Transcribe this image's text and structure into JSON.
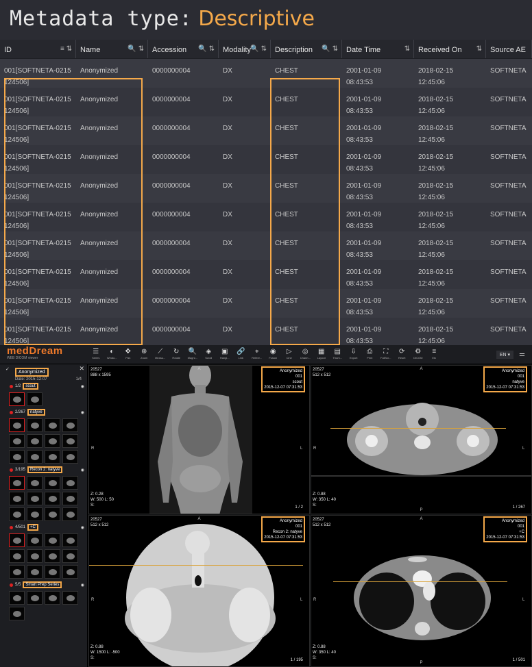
{
  "title": {
    "prefix": "Metadata type:",
    "accent": "Descriptive"
  },
  "table": {
    "columns": [
      "ID",
      "Name",
      "Accession",
      "Modality",
      "Description",
      "Date Time",
      "Received On",
      "Source AE"
    ],
    "column_icons": [
      "≡ ⇅",
      "🔍 ⇅",
      "🔍 ⇅",
      "🔍 ⇅",
      "🔍 ⇅",
      "⇅",
      "⇅",
      ""
    ],
    "rows": [
      [
        "001[SOFTNETA-0215124506]",
        "Anonymized",
        "0000000004",
        "DX",
        "CHEST",
        "2001-01-09 08:43:53",
        "2018-02-15 12:45:06",
        "SOFTNETA"
      ],
      [
        "001[SOFTNETA-0215124506]",
        "Anonymized",
        "0000000004",
        "DX",
        "CHEST",
        "2001-01-09 08:43:53",
        "2018-02-15 12:45:06",
        "SOFTNETA"
      ],
      [
        "001[SOFTNETA-0215124506]",
        "Anonymized",
        "0000000004",
        "DX",
        "CHEST",
        "2001-01-09 08:43:53",
        "2018-02-15 12:45:06",
        "SOFTNETA"
      ],
      [
        "001[SOFTNETA-0215124506]",
        "Anonymized",
        "0000000004",
        "DX",
        "CHEST",
        "2001-01-09 08:43:53",
        "2018-02-15 12:45:06",
        "SOFTNETA"
      ],
      [
        "001[SOFTNETA-0215124506]",
        "Anonymized",
        "0000000004",
        "DX",
        "CHEST",
        "2001-01-09 08:43:53",
        "2018-02-15 12:45:06",
        "SOFTNETA"
      ],
      [
        "001[SOFTNETA-0215124506]",
        "Anonymized",
        "0000000004",
        "DX",
        "CHEST",
        "2001-01-09 08:43:53",
        "2018-02-15 12:45:06",
        "SOFTNETA"
      ],
      [
        "001[SOFTNETA-0215124506]",
        "Anonymized",
        "0000000004",
        "DX",
        "CHEST",
        "2001-01-09 08:43:53",
        "2018-02-15 12:45:06",
        "SOFTNETA"
      ],
      [
        "001[SOFTNETA-0215124506]",
        "Anonymized",
        "0000000004",
        "DX",
        "CHEST",
        "2001-01-09 08:43:53",
        "2018-02-15 12:45:06",
        "SOFTNETA"
      ],
      [
        "001[SOFTNETA-0215124506]",
        "Anonymized",
        "0000000004",
        "DX",
        "CHEST",
        "2001-01-09 08:43:53",
        "2018-02-15 12:45:06",
        "SOFTNETA"
      ],
      [
        "001[SOFTNETA-0215124506]",
        "Anonymized",
        "0000000004",
        "DX",
        "CHEST",
        "2001-01-09 08:43:53",
        "2018-02-15 12:45:06",
        "SOFTNETA"
      ]
    ]
  },
  "viewer": {
    "logo": "medDream",
    "logo_sub": "WEB DICOM viewer",
    "tools": [
      {
        "icon": "☰",
        "label": "Series"
      },
      {
        "icon": "◐",
        "label": "Windo..."
      },
      {
        "icon": "✥",
        "label": "Pan"
      },
      {
        "icon": "⊕",
        "label": "Zoom"
      },
      {
        "icon": "⟋",
        "label": "Measu..."
      },
      {
        "icon": "↻",
        "label": "Rotate"
      },
      {
        "icon": "🔍",
        "label": "Magni..."
      },
      {
        "icon": "◈",
        "label": "Scroll"
      },
      {
        "icon": "▣",
        "label": "Hangi..."
      },
      {
        "icon": "🔗",
        "label": "Link"
      },
      {
        "icon": "⌖",
        "label": "Refere..."
      },
      {
        "icon": "◉",
        "label": "Fusion"
      },
      {
        "icon": "▷",
        "label": "Cine"
      },
      {
        "icon": "◎",
        "label": "Chann..."
      },
      {
        "icon": "▦",
        "label": "Layout"
      },
      {
        "icon": "▤",
        "label": "Thum..."
      },
      {
        "icon": "⇩",
        "label": "Export"
      },
      {
        "icon": "⎙",
        "label": "Print"
      },
      {
        "icon": "⛶",
        "label": "FullScr..."
      },
      {
        "icon": "⟳",
        "label": "Reset"
      },
      {
        "icon": "⚙",
        "label": "DICOM"
      },
      {
        "icon": "≡",
        "label": "Etc"
      }
    ],
    "lang": "EN ▾",
    "patient": "Anonymized",
    "date": "Date: 2015-12-07",
    "count": "1/4",
    "series": [
      {
        "num": "1/2",
        "name": "scout"
      },
      {
        "num": "2/267",
        "name": "natyve"
      },
      {
        "num": "3/195",
        "name": "Recon 2: natyve"
      },
      {
        "num": "4/501",
        "name": "+C"
      },
      {
        "num": "5/5",
        "name": "Smart Prep Series"
      }
    ],
    "viewports": [
      {
        "tl1": "20527",
        "tl2": "888 x 1595",
        "info": [
          "Anonymized",
          "001",
          "scout",
          "2015-12-07 07:31:53"
        ],
        "z": "Z: 0.28",
        "w": "W: 500 L: 50",
        "s": "S:",
        "page": "1 / 2"
      },
      {
        "tl1": "20527",
        "tl2": "512 x 512",
        "info": [
          "Anonymized",
          "001",
          "natyve",
          "2015-12-07 07:31:53"
        ],
        "z": "Z: 0.88",
        "w": "W: 350 L: 40",
        "s": "S:",
        "page": "1 / 267"
      },
      {
        "tl1": "20527",
        "tl2": "512 x 512",
        "info": [
          "Anonymized",
          "001",
          "Recon 2: natyve",
          "2015-12-07 07:31:53"
        ],
        "z": "Z: 0.88",
        "w": "W: 1500 L: -500",
        "s": "S:",
        "page": "1 / 195"
      },
      {
        "tl1": "20527",
        "tl2": "512 x 512",
        "info": [
          "Anonymized",
          "001",
          "+C",
          "2015-12-07 07:31:53"
        ],
        "z": "Z: 0.88",
        "w": "W: 350 L: 40",
        "s": "S:",
        "page": "1 / 501"
      }
    ],
    "orient": {
      "a": "A",
      "p": "P",
      "r": "R",
      "l": "L"
    }
  },
  "colors": {
    "accent": "#f5a94a",
    "logo": "#f07a2a"
  }
}
